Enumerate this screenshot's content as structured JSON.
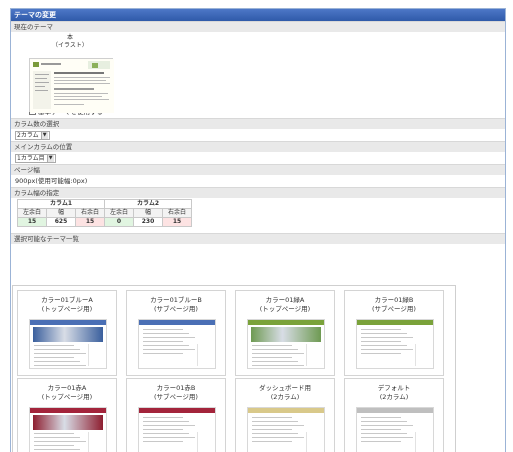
{
  "panel_title": "テーマの変更",
  "current_theme": {
    "section": "現在のテーマ",
    "name_line1": "本",
    "name_line2": "（イラスト）",
    "use_basic_label": "基本テーマを使用する"
  },
  "columns": {
    "section": "カラム数の選択",
    "selected": "2カラム"
  },
  "main_column": {
    "section": "メインカラムの位置",
    "selected": "1カラム目"
  },
  "page_width": {
    "section": "ページ幅",
    "value": "900px(使用可能幅:0px)"
  },
  "column_widths": {
    "section": "カラム幅の指定",
    "col1": "カラム1",
    "col2": "カラム2",
    "left_margin": "左余白",
    "width": "幅",
    "right_margin": "右余白",
    "c1_left": "15",
    "c1_width": "625",
    "c1_right": "15",
    "c2_left": "0",
    "c2_width": "230",
    "c2_right": "15"
  },
  "theme_list": {
    "section": "選択可能なテーマ一覧",
    "items": [
      {
        "line1": "カラー01ブルーA",
        "line2": "(トップページ用)",
        "accent": "#4a6fb5",
        "hero": "#3a5f9d"
      },
      {
        "line1": "カラー01ブルーB",
        "line2": "(サブページ用)",
        "accent": "#4a6fb5",
        "hero": ""
      },
      {
        "line1": "カラー01緑A",
        "line2": "(トップページ用)",
        "accent": "#7aa23a",
        "hero": "#6e9a52"
      },
      {
        "line1": "カラー01緑B",
        "line2": "(サブページ用)",
        "accent": "#7aa23a",
        "hero": ""
      },
      {
        "line1": "カラー01赤A",
        "line2": "(トップページ用)",
        "accent": "#a3243b",
        "hero": "#8e1e30"
      },
      {
        "line1": "カラー01赤B",
        "line2": "(サブページ用)",
        "accent": "#a3243b",
        "hero": ""
      },
      {
        "line1": "ダッシュボード用",
        "line2": "(2カラム)",
        "accent": "#d9c98a",
        "hero": ""
      },
      {
        "line1": "デフォルト",
        "line2": "(2カラム)",
        "accent": "#bfbfbf",
        "hero": ""
      }
    ]
  }
}
